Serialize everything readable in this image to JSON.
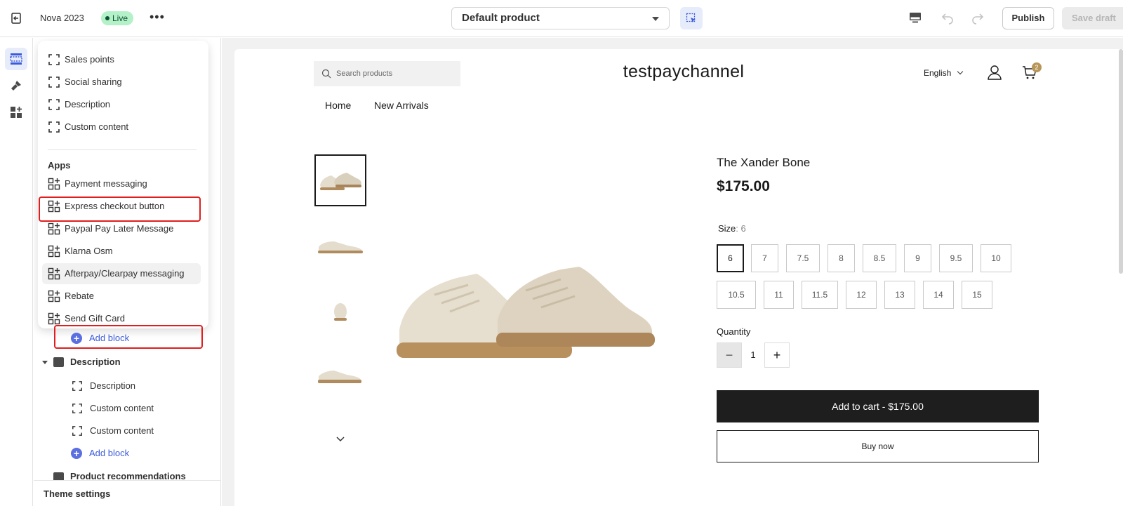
{
  "topbar": {
    "theme_name": "Nova 2023",
    "live_badge": "Live",
    "more_glyph": "•••",
    "template_select": "Default product",
    "publish_label": "Publish",
    "save_label": "Save draft"
  },
  "popover": {
    "items_top": [
      {
        "label": "Sales points",
        "icon": "dashed-block-icon"
      },
      {
        "label": "Social sharing",
        "icon": "dashed-block-icon"
      },
      {
        "label": "Description",
        "icon": "dashed-block-icon"
      },
      {
        "label": "Custom content",
        "icon": "dashed-block-icon"
      }
    ],
    "apps_heading": "Apps",
    "app_items": [
      {
        "label": "Payment messaging",
        "icon": "app-block-icon"
      },
      {
        "label": "Express checkout button",
        "icon": "app-block-icon",
        "highlighted": true
      },
      {
        "label": "Paypal Pay Later Message",
        "icon": "app-block-icon"
      },
      {
        "label": "Klarna Osm",
        "icon": "app-block-icon"
      },
      {
        "label": "Afterpay/Clearpay messaging",
        "icon": "app-block-icon",
        "hovered": true
      },
      {
        "label": "Rebate",
        "icon": "app-block-icon"
      },
      {
        "label": "Send Gift Card",
        "icon": "app-block-icon"
      }
    ]
  },
  "tree": {
    "add_block_1": "Add block",
    "description_section": "Description",
    "desc_children": [
      "Description",
      "Custom content",
      "Custom content"
    ],
    "add_block_2": "Add block",
    "product_recommendations": "Product recommendations",
    "theme_settings": "Theme settings"
  },
  "store": {
    "search_placeholder": "Search products",
    "name": "testpaychannel",
    "language": "English",
    "cart_count": "2",
    "nav": [
      "Home",
      "New Arrivals"
    ]
  },
  "product": {
    "title": "The Xander Bone",
    "price": "$175.00",
    "size_label": "Size",
    "size_selected": ": 6",
    "sizes_row1": [
      "6",
      "7",
      "7.5",
      "8",
      "8.5",
      "9",
      "9.5",
      "10"
    ],
    "sizes_row2": [
      "10.5",
      "11",
      "11.5",
      "12",
      "13",
      "14",
      "15"
    ],
    "quantity_label": "Quantity",
    "quantity": "1",
    "add_to_cart": "Add to cart  -  $175.00",
    "buy_now": "Buy now"
  },
  "colors": {
    "accent": "#3b5bdb",
    "highlight_box": "#e01e1e",
    "live_bg": "#b4f0c8",
    "cart_badge": "#b8965a",
    "primary_button": "#1e1e1e"
  }
}
